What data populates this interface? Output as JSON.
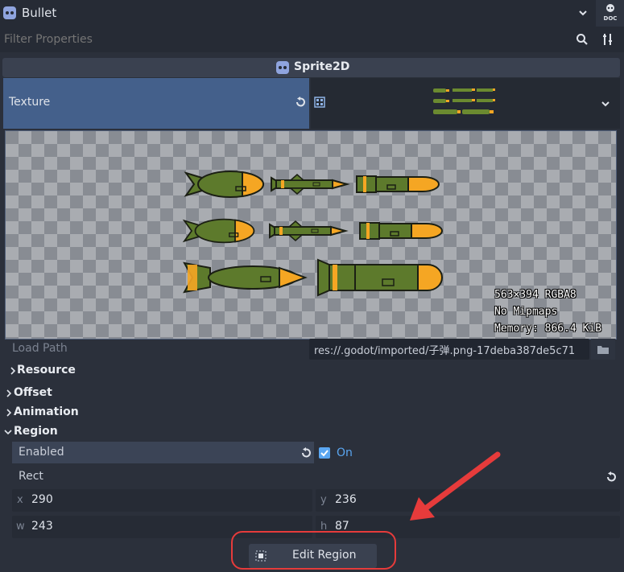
{
  "header": {
    "title": "Bullet"
  },
  "filter": {
    "placeholder": "Filter Properties"
  },
  "node": {
    "type": "Sprite2D"
  },
  "texture": {
    "label": "Texture"
  },
  "texture_info": {
    "dimensions": "563×394 RGBA8",
    "mipmaps": "No Mipmaps",
    "memory": "Memory: 866.4 KiB"
  },
  "load_path": {
    "label": "Load Path",
    "value": "res://.godot/imported/子弹.png-17deba387de5c71"
  },
  "sections": {
    "resource": "Resource",
    "offset": "Offset",
    "animation": "Animation",
    "region": "Region"
  },
  "region": {
    "enabled_label": "Enabled",
    "enabled_value": "On",
    "rect_label": "Rect",
    "x_label": "x",
    "x_value": "290",
    "y_label": "y",
    "y_value": "236",
    "w_label": "w",
    "w_value": "243",
    "h_label": "h",
    "h_value": "87"
  },
  "edit_region": {
    "label": "Edit Region"
  },
  "colors": {
    "accent": "#5aa6f1",
    "selected_row": "#44608b",
    "annotation": "#e63b3b",
    "bullet_green": "#5d7a2c",
    "bullet_tip": "#f5a623"
  }
}
